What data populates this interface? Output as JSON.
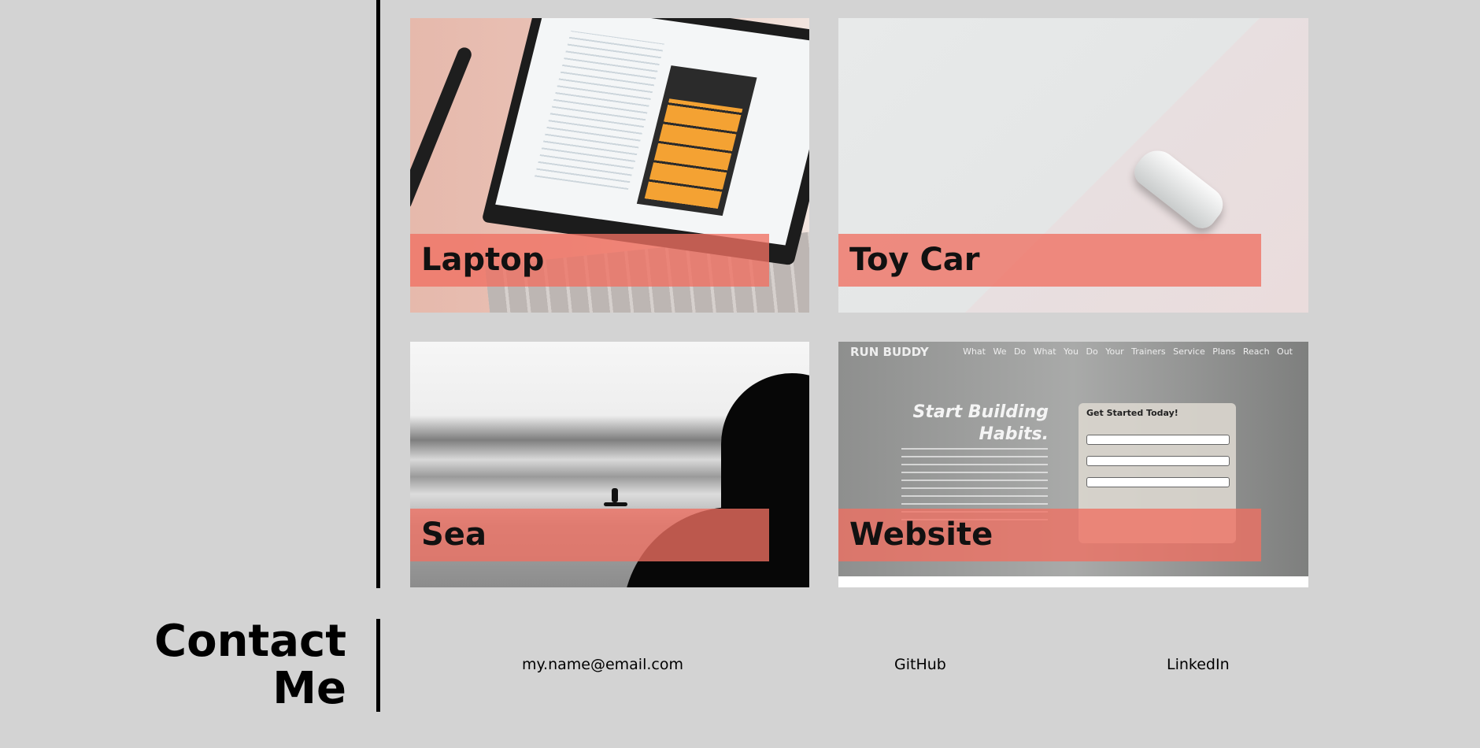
{
  "projects": [
    {
      "title": "Laptop"
    },
    {
      "title": "Toy Car"
    },
    {
      "title": "Sea"
    },
    {
      "title": "Website"
    }
  ],
  "website_preview": {
    "brand": "RUN BUDDY",
    "nav": "What We Do   What You Do   Your Trainers   Service Plans   Reach Out",
    "hero": "Start Building Habits.",
    "form_title": "Get Started Today!"
  },
  "contact": {
    "title_line1": "Contact",
    "title_line2": "Me",
    "email": "my.name@email.com",
    "github": "GitHub",
    "linkedin": "LinkedIn"
  },
  "colors": {
    "background": "#d3d3d3",
    "label_overlay": "#f07062",
    "divider": "#000000"
  }
}
